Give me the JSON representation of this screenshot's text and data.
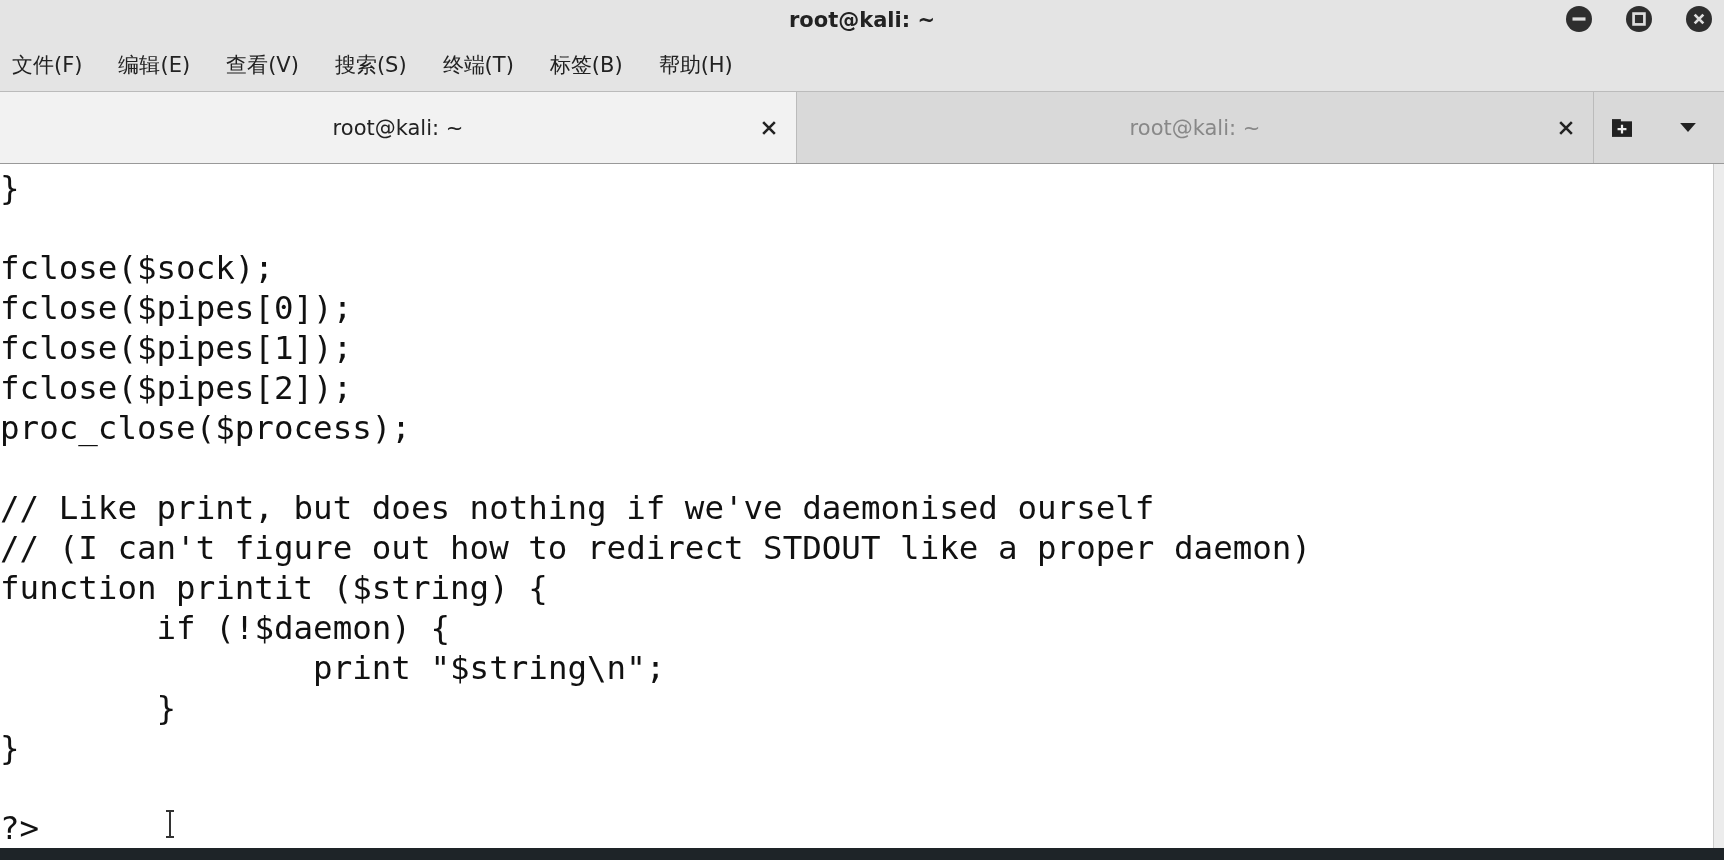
{
  "window": {
    "title": "root@kali: ~"
  },
  "menu": [
    "文件(F)",
    "编辑(E)",
    "查看(V)",
    "搜索(S)",
    "终端(T)",
    "标签(B)",
    "帮助(H)"
  ],
  "tabs": [
    {
      "label": "root@kali: ~",
      "selected": true
    },
    {
      "label": "root@kali: ~",
      "selected": false
    }
  ],
  "terminal": {
    "lines": [
      {
        "kind": "code",
        "text": "}"
      },
      {
        "kind": "blank"
      },
      {
        "kind": "code",
        "text": "fclose($sock);"
      },
      {
        "kind": "code",
        "text": "fclose($pipes[0]);"
      },
      {
        "kind": "code",
        "text": "fclose($pipes[1]);"
      },
      {
        "kind": "code",
        "text": "fclose($pipes[2]);"
      },
      {
        "kind": "code",
        "text": "proc_close($process);"
      },
      {
        "kind": "blank"
      },
      {
        "kind": "code",
        "text": "// Like print, but does nothing if we've daemonised ourself"
      },
      {
        "kind": "code",
        "text": "// (I can't figure out how to redirect STDOUT like a proper daemon)"
      },
      {
        "kind": "code",
        "text": "function printit ($string) {"
      },
      {
        "kind": "code",
        "text": "\tif (!$daemon) {"
      },
      {
        "kind": "code",
        "text": "\t\tprint \"$string\\n\";"
      },
      {
        "kind": "code",
        "text": "\t}"
      },
      {
        "kind": "code",
        "text": "}"
      },
      {
        "kind": "blank"
      },
      {
        "kind": "code",
        "text": "?>"
      }
    ]
  }
}
